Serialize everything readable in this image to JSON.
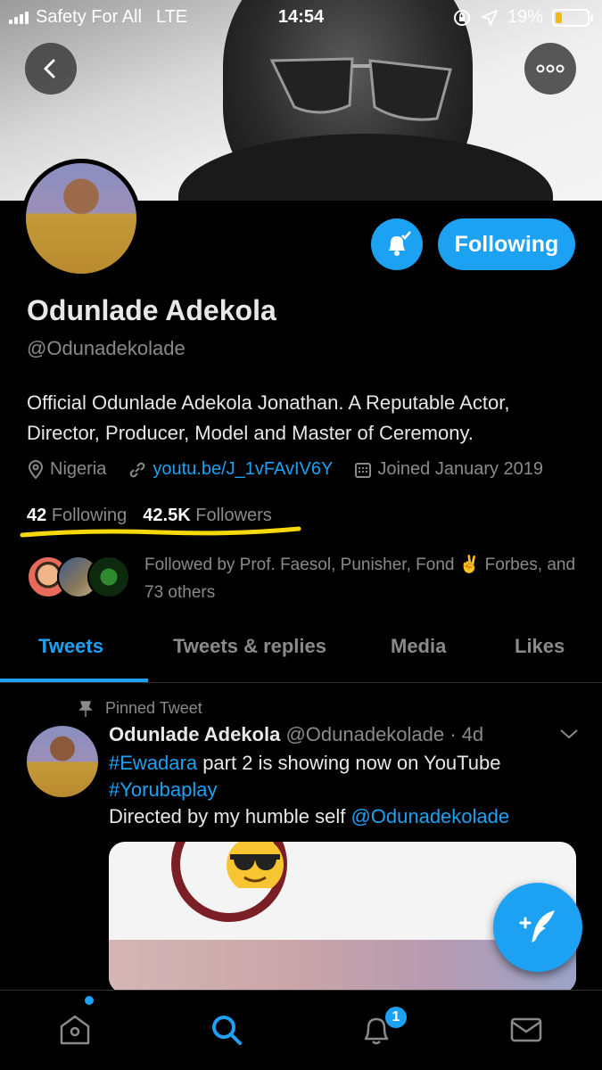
{
  "status": {
    "carrier": "Safety For All",
    "network": "LTE",
    "time": "14:54",
    "battery": "19%"
  },
  "profile": {
    "following_label": "Following",
    "name": "Odunlade Adekola",
    "handle": "@Odunadekolade",
    "bio": "Official Odunlade Adekola Jonathan. A Reputable Actor, Director, Producer, Model and Master of Ceremony.",
    "location": "Nigeria",
    "link": "youtu.be/J_1vFAvIV6Y",
    "joined": "Joined January 2019",
    "following_count": "42",
    "following_word": "Following",
    "followers_count": "42.5K",
    "followers_word": "Followers",
    "followed_by": "Followed by Prof. Faesol, Punisher, Fond ✌ Forbes, and 73 others"
  },
  "tabs": [
    "Tweets",
    "Tweets & replies",
    "Media",
    "Likes"
  ],
  "tweet": {
    "pinned_label": "Pinned Tweet",
    "name": "Odunlade Adekola",
    "handle_time": "@Odunadekolade · 4d",
    "hashtag1": "#Ewadara",
    "text1": " part 2 is showing now on YouTube",
    "hashtag2": "#Yorubaplay",
    "text2": "Directed by my humble self ",
    "mention": "@Odunadekolade"
  },
  "nav": {
    "notification_badge": "1"
  },
  "colors": {
    "accent": "#1da1f2",
    "background": "#000000",
    "muted": "#8a8a8a",
    "highlight_underline": "#f5d90a"
  }
}
